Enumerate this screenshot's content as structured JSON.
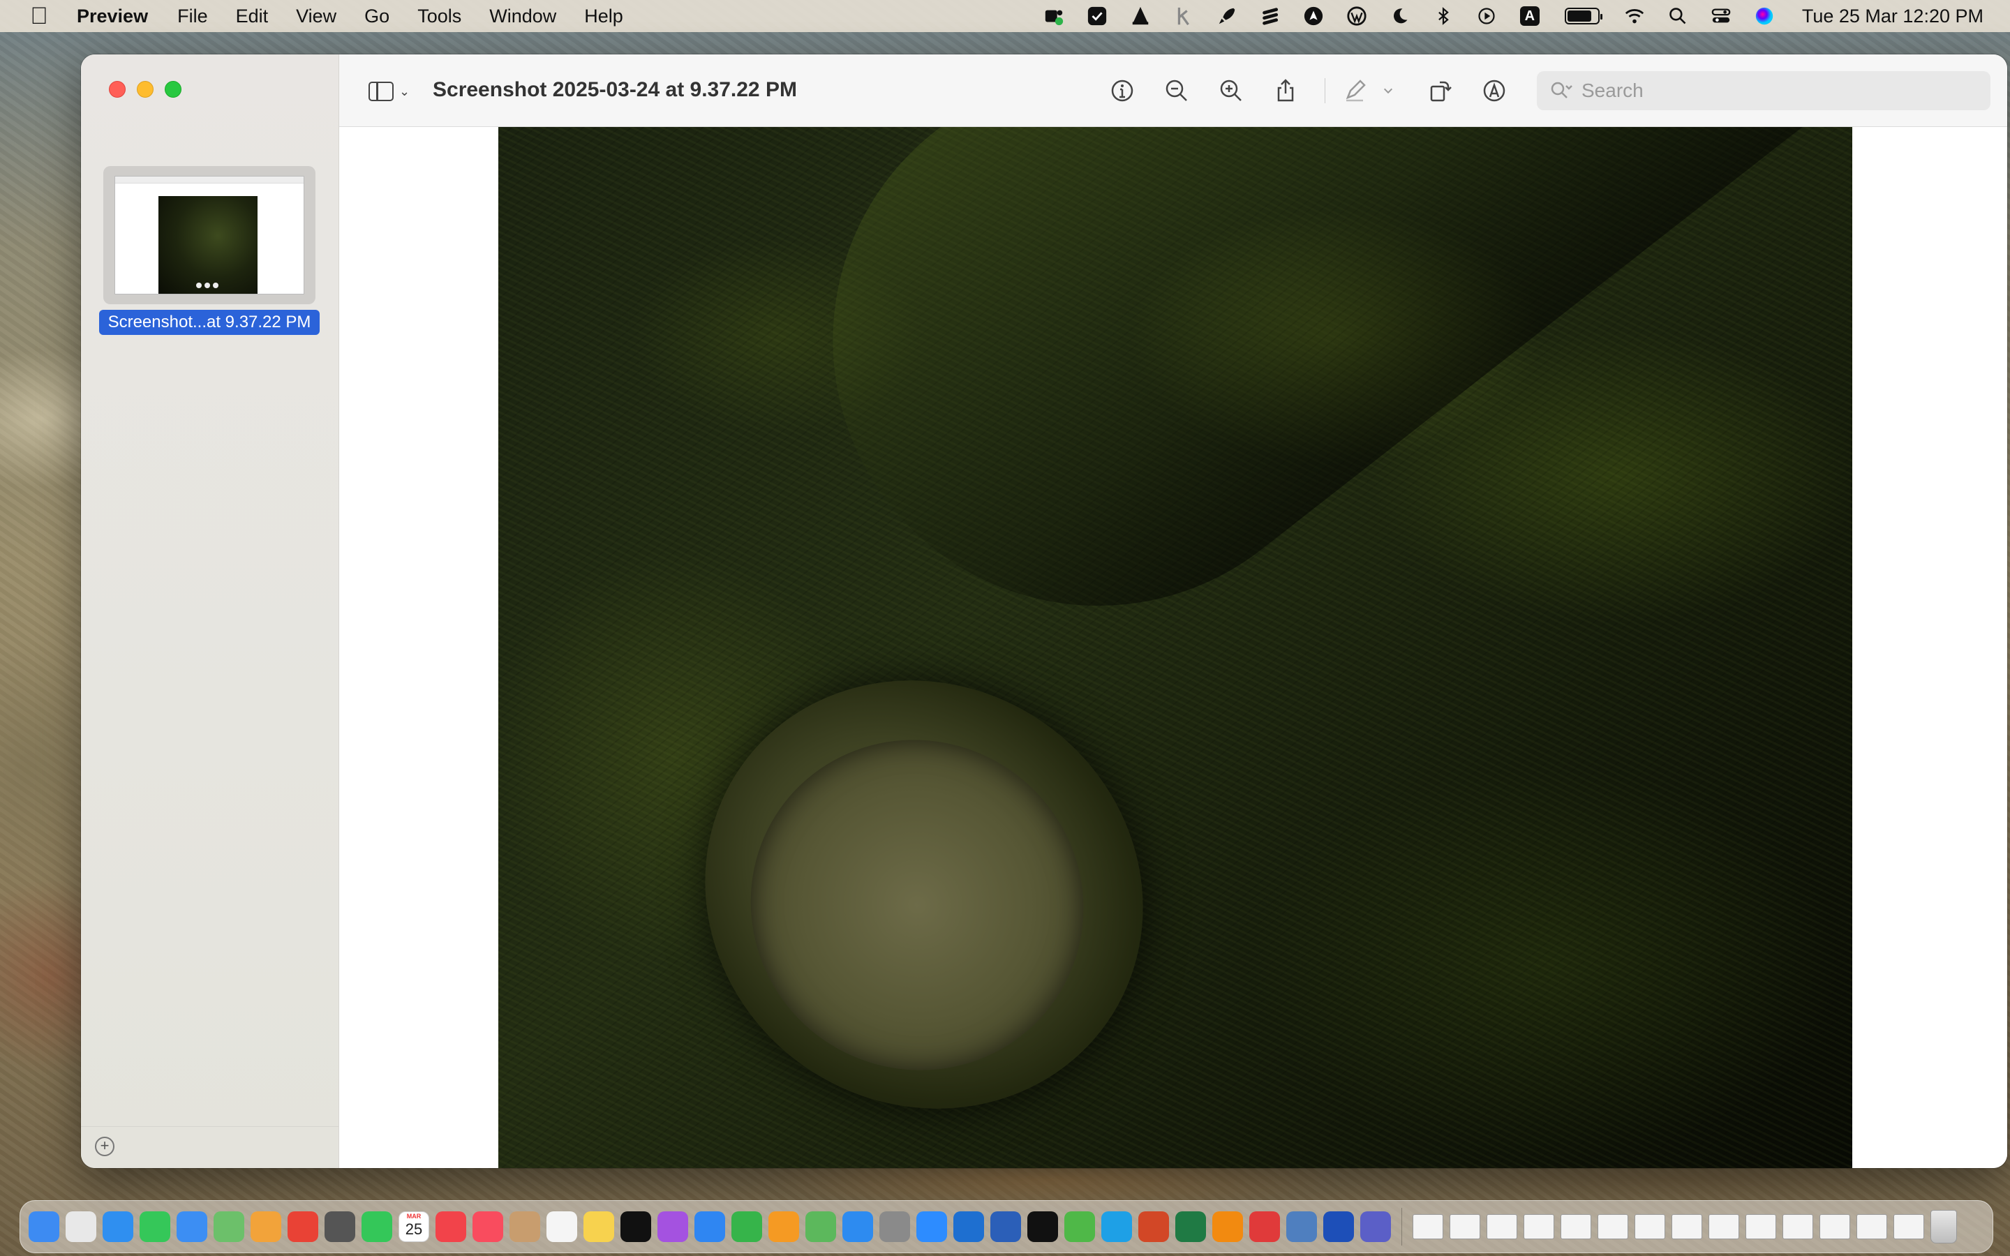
{
  "menubar": {
    "app_name": "Preview",
    "menus": [
      "File",
      "Edit",
      "View",
      "Go",
      "Tools",
      "Window",
      "Help"
    ],
    "clock": "Tue 25 Mar  12:20 PM",
    "status_icons": [
      "teams-icon",
      "checkmark-icon",
      "vlc-icon",
      "k-icon",
      "rocket-icon",
      "bars-icon",
      "pen-nib-icon",
      "wordpress-icon",
      "moon-icon",
      "bluetooth-icon",
      "play-icon",
      "keyboard-a-icon",
      "battery-icon",
      "wifi-icon",
      "search-icon",
      "control-center-icon",
      "siri-icon"
    ],
    "keyboard_letter": "A"
  },
  "window": {
    "title": "Screenshot 2025-03-24 at 9.37.22 PM",
    "sidebar": {
      "thumbnail_label": "Screenshot...at 9.37.22 PM"
    },
    "toolbar": {
      "icons": [
        "info-icon",
        "zoom-out-icon",
        "zoom-in-icon",
        "share-icon",
        "markup-pen-icon",
        "chevron-down-icon",
        "rotate-icon",
        "markup-icon"
      ],
      "search_placeholder": "Search"
    }
  },
  "dock": {
    "calendar_day": "25",
    "calendar_month": "MAR",
    "apps": [
      {
        "name": "finder",
        "color": "#3d8bf2"
      },
      {
        "name": "launchpad",
        "color": "#e8e8e8"
      },
      {
        "name": "safari",
        "color": "#2f8ff0"
      },
      {
        "name": "messages",
        "color": "#35c759"
      },
      {
        "name": "mail",
        "color": "#3c8ef3"
      },
      {
        "name": "maps",
        "color": "#6cc06a"
      },
      {
        "name": "photos",
        "color": "#f2a33a"
      },
      {
        "name": "chrome",
        "color": "#e94235"
      },
      {
        "name": "calculator",
        "color": "#555555"
      },
      {
        "name": "facetime",
        "color": "#34c759"
      },
      {
        "name": "calendar",
        "color": "#ffffff"
      },
      {
        "name": "news",
        "color": "#f2434a"
      },
      {
        "name": "music",
        "color": "#f94c5e"
      },
      {
        "name": "contacts",
        "color": "#c89d6e"
      },
      {
        "name": "reminders",
        "color": "#f5f5f5"
      },
      {
        "name": "notes",
        "color": "#f7d24e"
      },
      {
        "name": "apple-tv",
        "color": "#111111"
      },
      {
        "name": "podcasts",
        "color": "#a452e0"
      },
      {
        "name": "keynote",
        "color": "#2f86f2"
      },
      {
        "name": "numbers",
        "color": "#36b44a"
      },
      {
        "name": "pages",
        "color": "#f59a23"
      },
      {
        "name": "icloud",
        "color": "#5cb85c"
      },
      {
        "name": "app-store",
        "color": "#2d8bf0"
      },
      {
        "name": "system-settings",
        "color": "#8a8a8a"
      },
      {
        "name": "zoom",
        "color": "#2d8cff"
      },
      {
        "name": "outlook",
        "color": "#1e6fd0"
      },
      {
        "name": "word",
        "color": "#2b5fb8"
      },
      {
        "name": "chatgpt",
        "color": "#111111"
      },
      {
        "name": "utorrent",
        "color": "#4fb848"
      },
      {
        "name": "skype",
        "color": "#1ea0e6"
      },
      {
        "name": "powerpoint",
        "color": "#d24726"
      },
      {
        "name": "excel",
        "color": "#1f7a44"
      },
      {
        "name": "vlc",
        "color": "#f28a10"
      },
      {
        "name": "speedify",
        "color": "#e03a3a"
      },
      {
        "name": "preview",
        "color": "#4f7fbf"
      },
      {
        "name": "audio-app",
        "color": "#1d4fb8"
      },
      {
        "name": "teams",
        "color": "#5b5fc7"
      }
    ],
    "window_count": 14
  }
}
